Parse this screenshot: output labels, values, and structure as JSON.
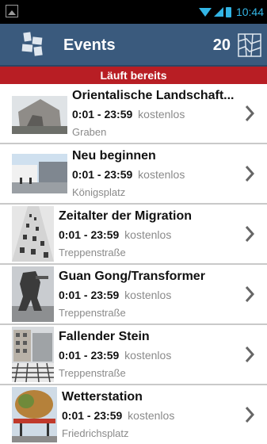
{
  "statusbar": {
    "time": "10:44",
    "icons": [
      "image-icon",
      "wifi-icon",
      "signal-icon",
      "battery-icon"
    ]
  },
  "actionbar": {
    "title": "Events",
    "count": "20",
    "icons": [
      "app-logo-icon",
      "map-icon"
    ]
  },
  "section": {
    "label": "Läuft bereits",
    "color": "#b81e24"
  },
  "events": [
    {
      "title": "Orientalische Landschaft...",
      "time": "0:01 - 23:59",
      "price": "kostenlos",
      "place": "Graben"
    },
    {
      "title": "Neu beginnen",
      "time": "0:01 - 23:59",
      "price": "kostenlos",
      "place": "Königsplatz"
    },
    {
      "title": "Zeitalter der Migration",
      "time": "0:01 - 23:59",
      "price": "kostenlos",
      "place": "Treppenstraße"
    },
    {
      "title": "Guan Gong/Transformer",
      "time": "0:01 - 23:59",
      "price": "kostenlos",
      "place": "Treppenstraße"
    },
    {
      "title": "Fallender Stein",
      "time": "0:01 - 23:59",
      "price": "kostenlos",
      "place": "Treppenstraße"
    },
    {
      "title": "Wetterstation",
      "time": "0:01 - 23:59",
      "price": "kostenlos",
      "place": "Friedrichsplatz"
    }
  ],
  "colors": {
    "actionbar": "#3a5a7d",
    "status_accent": "#33b5e5",
    "text_muted": "#8a8a8a"
  }
}
